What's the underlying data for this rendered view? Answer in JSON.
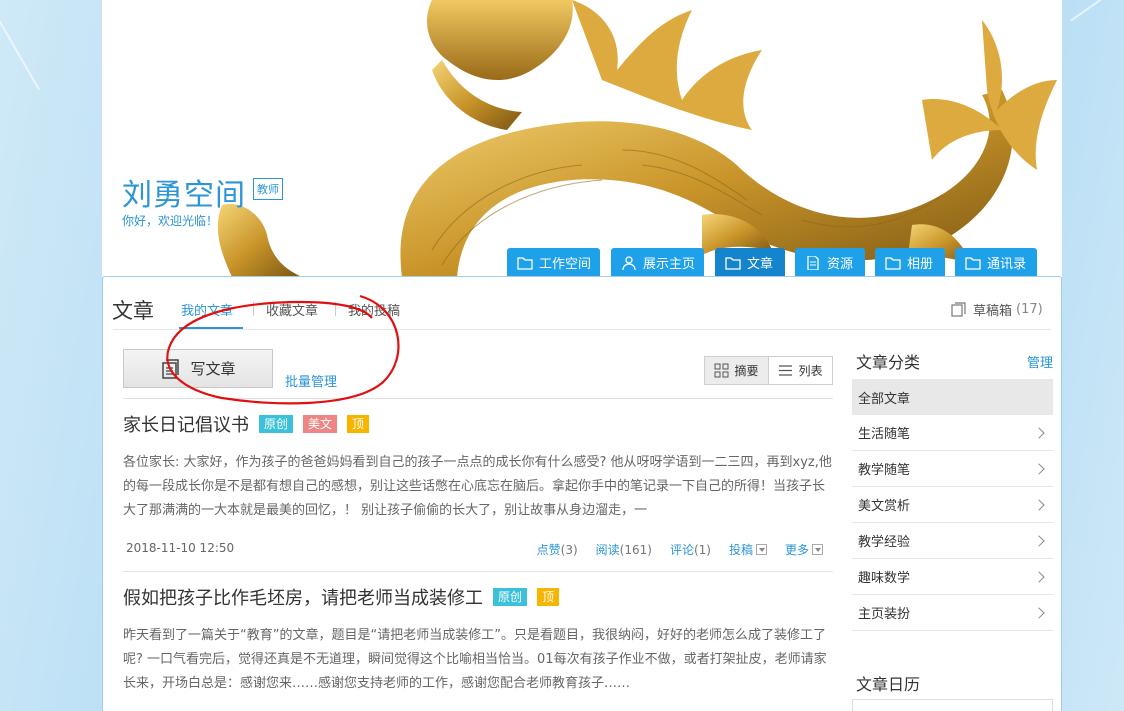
{
  "banner": {
    "site_title": "刘勇空间",
    "badge": "教师",
    "welcome": "你好，欢迎光临！"
  },
  "nav": [
    {
      "label": "工作空间",
      "icon": "folder-icon"
    },
    {
      "label": "展示主页",
      "icon": "user-icon"
    },
    {
      "label": "文章",
      "icon": "folder-icon",
      "active": true
    },
    {
      "label": "资源",
      "icon": "document-icon"
    },
    {
      "label": "相册",
      "icon": "folder-icon"
    },
    {
      "label": "通讯录",
      "icon": "folder-icon"
    }
  ],
  "section": {
    "heading": "文章",
    "tabs": [
      "我的文章",
      "收藏文章",
      "我的投稿"
    ],
    "active_tab": "我的文章",
    "drafts_label": "草稿箱",
    "drafts_count": "(17)"
  },
  "toolbar": {
    "write_label": "写文章",
    "batch_label": "批量管理",
    "view_summary": "摘要",
    "view_list": "列表"
  },
  "articles": [
    {
      "title": "家长日记倡议书",
      "tags": [
        "原创",
        "美文",
        "顶"
      ],
      "excerpt": "各位家长: 大家好，作为孩子的爸爸妈妈看到自己的孩子一点点的成长你有什么感受? 他从呀呀学语到一二三四，再到xyz,他的每一段成长你是不是都有想自己的感想，别让这些话憋在心底忘在脑后。拿起你手中的笔记录一下自己的所得！当孩子长大了那满满的一大本就是最美的回忆，！ 别让孩子偷偷的长大了，别让故事从身边溜走，一",
      "date": "2018-11-10 12:50",
      "likes_label": "点赞",
      "likes": "(3)",
      "reads_label": "阅读",
      "reads": "(161)",
      "comments_label": "评论",
      "comments": "(1)",
      "submit_label": "投稿",
      "more_label": "更多"
    },
    {
      "title": "假如把孩子比作毛坯房，请把老师当成装修工",
      "tags": [
        "原创",
        "顶"
      ],
      "excerpt": "昨天看到了一篇关于“教育”的文章，题目是“请把老师当成装修工”。只是看题目，我很纳闷，好好的老师怎么成了装修工了呢? 一口气看完后，觉得还真是不无道理，瞬间觉得这个比喻相当恰当。01每次有孩子作业不做，或者打架扯皮，老师请家长来，开场白总是：感谢您来……感谢您支持老师的工作，感谢您配合老师教育孩子……"
    }
  ],
  "sidebar": {
    "title": "文章分类",
    "manage": "管理",
    "items": [
      "全部文章",
      "生活随笔",
      "教学随笔",
      "美文赏析",
      "教学经验",
      "趣味数学",
      "主页装扮"
    ],
    "calendar_title": "文章日历"
  },
  "colors": {
    "accent": "#2b95d7",
    "nav_bg": "#1ea1e8",
    "nav_active": "#1484cc",
    "tag_original": "#3bc1d9",
    "tag_beauty": "#ee8686",
    "tag_top": "#f7b500",
    "annotation_red": "#e01010"
  }
}
